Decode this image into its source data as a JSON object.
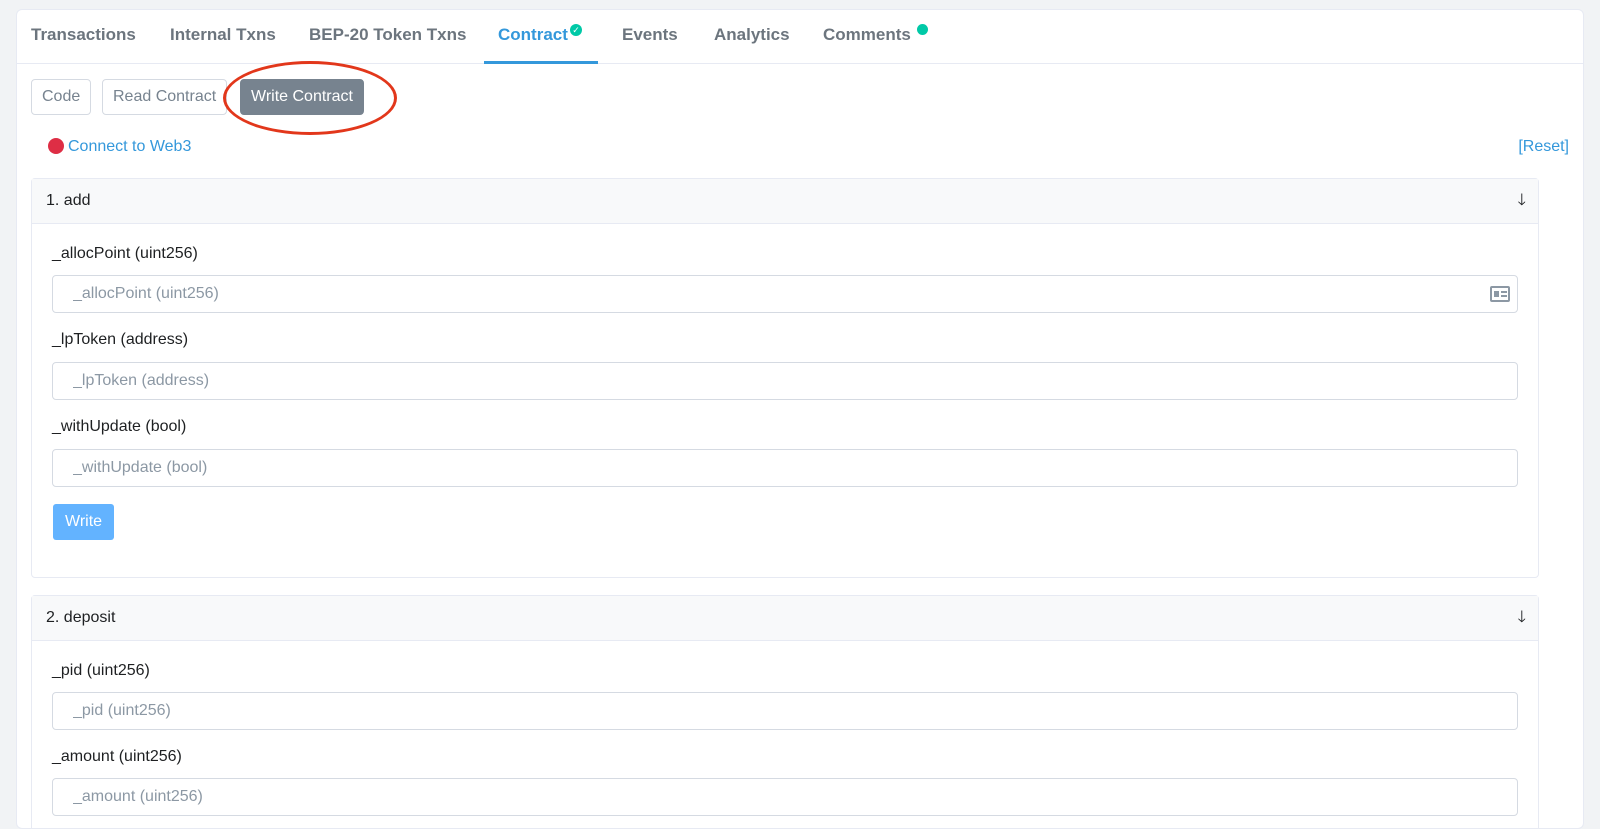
{
  "tabs": [
    {
      "label": "Transactions"
    },
    {
      "label": "Internal Txns"
    },
    {
      "label": "BEP-20 Token Txns"
    },
    {
      "label": "Contract",
      "active": true,
      "badge": "check"
    },
    {
      "label": "Events"
    },
    {
      "label": "Analytics"
    },
    {
      "label": "Comments",
      "badge": "dot"
    }
  ],
  "subtabs": [
    {
      "label": "Code"
    },
    {
      "label": "Read Contract"
    },
    {
      "label": "Write Contract",
      "active": true
    }
  ],
  "connect_label": "Connect to Web3",
  "reset_label": "[Reset]",
  "functions": [
    {
      "title": "1. add",
      "fields": [
        {
          "label": "_allocPoint (uint256)",
          "placeholder": "_allocPoint (uint256)"
        },
        {
          "label": "_lpToken (address)",
          "placeholder": "_lpToken (address)"
        },
        {
          "label": "_withUpdate (bool)",
          "placeholder": "_withUpdate (bool)"
        }
      ],
      "write_label": "Write"
    },
    {
      "title": "2. deposit",
      "fields": [
        {
          "label": "_pid (uint256)",
          "placeholder": "_pid (uint256)"
        },
        {
          "label": "_amount (uint256)",
          "placeholder": "_amount (uint256)"
        }
      ]
    }
  ],
  "colors": {
    "accent": "#3498db",
    "active_subtab": "#77838f",
    "write_button": "#63b3ff",
    "disconnected_dot": "#de2e45",
    "badge": "#00c9a7",
    "annotation": "#e2371b"
  }
}
